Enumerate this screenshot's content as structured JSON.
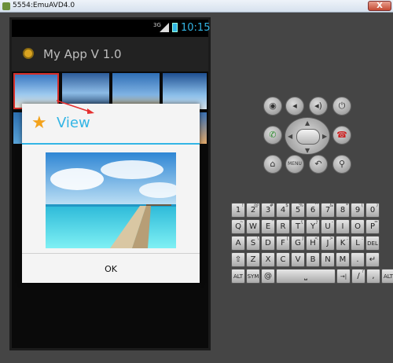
{
  "window": {
    "title": "5554:EmuAVD4.0",
    "close_glyph": "X"
  },
  "status_bar": {
    "network": "3G",
    "time": "10:15"
  },
  "action_bar": {
    "title": "My App V 1.0",
    "icon": "app-icon"
  },
  "dialog": {
    "title": "View",
    "icon": "star-icon",
    "button_ok": "OK",
    "image_caption": ""
  },
  "controls": {
    "row1": [
      "camera-icon",
      "volume-down-icon",
      "volume-up-icon",
      "power-icon"
    ],
    "call": "call-icon",
    "end_call": "end-call-icon",
    "row3": [
      "home-icon",
      "MENU",
      "back-icon",
      "search-icon"
    ]
  },
  "keyboard": {
    "row1": [
      {
        "k": "1",
        "s": "!"
      },
      {
        "k": "2",
        "s": "@"
      },
      {
        "k": "3",
        "s": "#"
      },
      {
        "k": "4",
        "s": "$"
      },
      {
        "k": "5",
        "s": "%"
      },
      {
        "k": "6",
        "s": "^"
      },
      {
        "k": "7",
        "s": "&"
      },
      {
        "k": "8",
        "s": "*"
      },
      {
        "k": "9",
        "s": "("
      },
      {
        "k": "0",
        "s": ")"
      }
    ],
    "row2": [
      {
        "k": "Q",
        "s": "~"
      },
      {
        "k": "W",
        "s": ""
      },
      {
        "k": "E",
        "s": "\""
      },
      {
        "k": "R",
        "s": ""
      },
      {
        "k": "T",
        "s": "{"
      },
      {
        "k": "Y",
        "s": "}"
      },
      {
        "k": "U",
        "s": "-"
      },
      {
        "k": "I",
        "s": ""
      },
      {
        "k": "O",
        "s": ""
      },
      {
        "k": "P",
        "s": "="
      }
    ],
    "row3": [
      {
        "k": "A",
        "s": ""
      },
      {
        "k": "S",
        "s": "\\"
      },
      {
        "k": "D",
        "s": ""
      },
      {
        "k": "F",
        "s": "["
      },
      {
        "k": "G",
        "s": "]"
      },
      {
        "k": "H",
        "s": "<"
      },
      {
        "k": "J",
        "s": ">"
      },
      {
        "k": "K",
        "s": ";"
      },
      {
        "k": "L",
        "s": ":"
      },
      {
        "k": "DEL",
        "s": ""
      }
    ],
    "row4": [
      {
        "k": "⇧",
        "s": ""
      },
      {
        "k": "Z",
        "s": ""
      },
      {
        "k": "X",
        "s": ""
      },
      {
        "k": "C",
        "s": ""
      },
      {
        "k": "V",
        "s": ""
      },
      {
        "k": "B",
        "s": ""
      },
      {
        "k": "N",
        "s": ""
      },
      {
        "k": "M",
        "s": ""
      },
      {
        "k": ".",
        "s": ""
      },
      {
        "k": "↵",
        "s": ""
      }
    ],
    "row5": [
      {
        "k": "ALT",
        "s": ""
      },
      {
        "k": "SYM",
        "s": ""
      },
      {
        "k": "@",
        "s": ""
      },
      {
        "k": "␣",
        "s": ""
      },
      {
        "k": "→|",
        "s": ""
      },
      {
        "k": "/",
        "s": "?"
      },
      {
        "k": ",",
        "s": ""
      },
      {
        "k": "ALT",
        "s": ""
      }
    ]
  },
  "colors": {
    "accent": "#33b5e5",
    "emulator_bg": "#454545",
    "dialog_bg": "#f4f4f4",
    "star": "#f3a21b"
  }
}
